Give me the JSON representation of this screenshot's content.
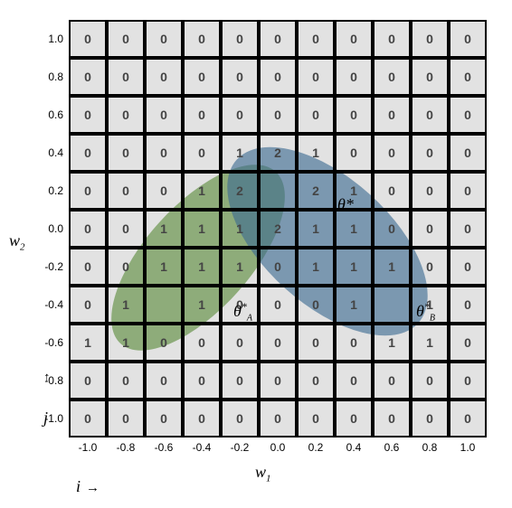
{
  "axis_y": "w",
  "axis_y_sub": "2",
  "axis_x": "w",
  "axis_x_sub": "1",
  "corner_j": "j",
  "corner_i": "i",
  "corner_i_arrow": "→",
  "corner_j_arrow": "↑",
  "row_ticks": [
    "1.0",
    "0.8",
    "0.6",
    "0.4",
    "0.2",
    "0.0",
    "-0.2",
    "-0.4",
    "-0.6",
    "-0.8",
    "-1.0"
  ],
  "col_ticks": [
    "-1.0",
    "-0.8",
    "-0.6",
    "-0.4",
    "-0.2",
    "0.0",
    "0.2",
    "0.4",
    "0.6",
    "0.8",
    "1.0"
  ],
  "theta_star": "θ*",
  "theta_a": "θ",
  "theta_a_sup": "*",
  "theta_a_sub": "A",
  "theta_b": "θ",
  "theta_b_sup": "*",
  "theta_b_sub": "B",
  "chart_data": {
    "type": "heatmap",
    "title": "",
    "xlabel": "w1",
    "ylabel": "w2",
    "x_ticks": [
      -1.0,
      -0.8,
      -0.6,
      -0.4,
      -0.2,
      0.0,
      0.2,
      0.4,
      0.6,
      0.8,
      1.0
    ],
    "y_ticks": [
      1.0,
      0.8,
      0.6,
      0.4,
      0.2,
      0.0,
      -0.2,
      -0.4,
      -0.6,
      -0.8,
      -1.0
    ],
    "grid": [
      [
        0,
        0,
        0,
        0,
        0,
        0,
        0,
        0,
        0,
        0,
        0
      ],
      [
        0,
        0,
        0,
        0,
        0,
        0,
        0,
        0,
        0,
        0,
        0
      ],
      [
        0,
        0,
        0,
        0,
        0,
        0,
        0,
        0,
        0,
        0,
        0
      ],
      [
        0,
        0,
        0,
        0,
        1,
        2,
        1,
        0,
        0,
        0,
        0
      ],
      [
        0,
        0,
        0,
        1,
        2,
        null,
        2,
        1,
        0,
        0,
        0
      ],
      [
        0,
        0,
        1,
        1,
        1,
        2,
        1,
        1,
        0,
        0,
        0
      ],
      [
        0,
        0,
        1,
        1,
        1,
        0,
        1,
        1,
        1,
        0,
        0
      ],
      [
        0,
        1,
        null,
        1,
        0,
        0,
        0,
        1,
        null,
        1,
        0
      ],
      [
        1,
        1,
        0,
        0,
        0,
        0,
        0,
        0,
        1,
        1,
        0
      ],
      [
        0,
        0,
        0,
        0,
        0,
        0,
        0,
        0,
        0,
        0,
        0
      ],
      [
        0,
        0,
        0,
        0,
        0,
        0,
        0,
        0,
        0,
        0,
        0
      ]
    ],
    "ellipses": [
      {
        "name": "A",
        "center": [
          -0.42,
          -0.15
        ],
        "rx": 0.55,
        "ry": 0.25,
        "angle": 48,
        "color": "#5a8a3a",
        "label": "θ*_A",
        "label_at": [
          -0.6,
          -0.4
        ]
      },
      {
        "name": "B",
        "center": [
          0.26,
          -0.08
        ],
        "rx": 0.58,
        "ry": 0.3,
        "angle": -42,
        "color": "#3b6a92",
        "label": "θ*_B",
        "label_at": [
          0.6,
          -0.4
        ]
      }
    ],
    "annotations": [
      {
        "text": "θ*",
        "at": [
          0.0,
          0.2
        ]
      }
    ]
  }
}
